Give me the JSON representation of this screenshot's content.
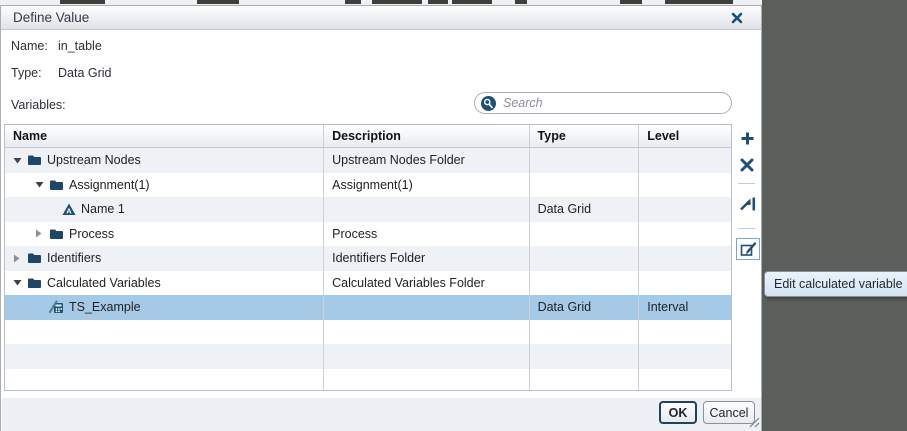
{
  "dialog": {
    "title": "Define Value",
    "fields": {
      "name_label": "Name:",
      "name_value": "in_table",
      "type_label": "Type:",
      "type_value": "Data Grid"
    },
    "variables_label": "Variables:",
    "search": {
      "placeholder": "Search"
    }
  },
  "table": {
    "columns": [
      "Name",
      "Description",
      "Type",
      "Level"
    ],
    "rows": [
      {
        "name": "Upstream Nodes",
        "description": "Upstream Nodes Folder",
        "type": "",
        "level": "",
        "state": "expanded",
        "icon": "folder"
      },
      {
        "name": "Assignment(1)",
        "description": "Assignment(1)",
        "type": "",
        "level": "",
        "state": "expanded",
        "icon": "folder"
      },
      {
        "name": "Name 1",
        "description": "",
        "type": "Data Grid",
        "level": "",
        "state": "leaf",
        "icon": "variable-triangle"
      },
      {
        "name": "Process",
        "description": "Process",
        "type": "",
        "level": "",
        "state": "collapsed",
        "icon": "folder"
      },
      {
        "name": "Identifiers",
        "description": "Identifiers Folder",
        "type": "",
        "level": "",
        "state": "collapsed",
        "icon": "folder"
      },
      {
        "name": "Calculated Variables",
        "description": "Calculated Variables Folder",
        "type": "",
        "level": "",
        "state": "expanded",
        "icon": "folder"
      },
      {
        "name": "TS_Example",
        "description": "",
        "type": "Data Grid",
        "level": "Interval",
        "state": "leaf",
        "icon": "calculated-variable",
        "selected": true
      }
    ]
  },
  "toolbar": {
    "icons": [
      "add",
      "delete",
      "move",
      "edit-calculated-variable"
    ]
  },
  "tooltip": {
    "text": "Edit calculated variable"
  },
  "footer": {
    "ok_label": "OK",
    "cancel_label": "Cancel"
  },
  "colors": {
    "accent": "#1e4f78",
    "selection": "#a5cae7",
    "backdrop": "#5b5f5b",
    "alt_row": "#eef1f5"
  }
}
